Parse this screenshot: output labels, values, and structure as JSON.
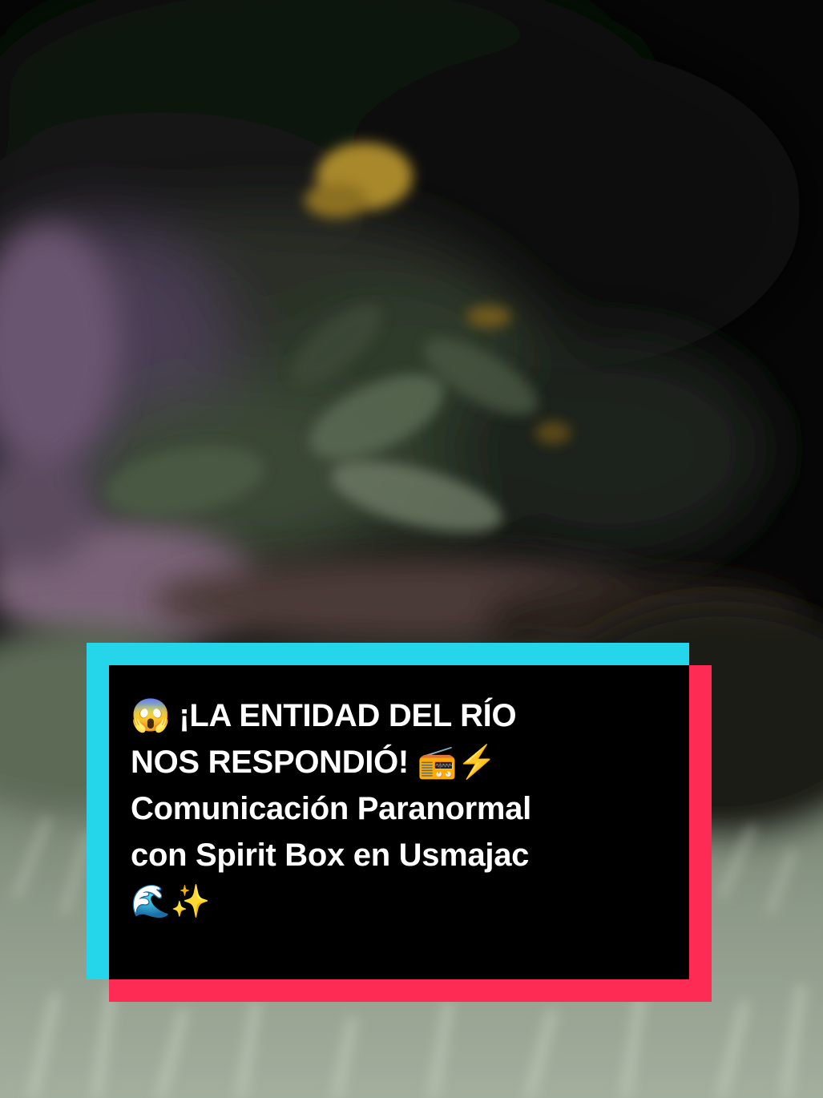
{
  "caption": {
    "lines": [
      "😱 ¡LA ENTIDAD DEL RÍO",
      "NOS RESPONDIÓ! 📻⚡",
      "Comunicación Paranormal",
      "con Spirit Box en Usmajac",
      "🌊✨"
    ]
  },
  "colors": {
    "caption_background": "#000000",
    "caption_text": "#ffffff",
    "accent_cyan": "#25d5ea",
    "accent_red": "#fe2c55"
  }
}
